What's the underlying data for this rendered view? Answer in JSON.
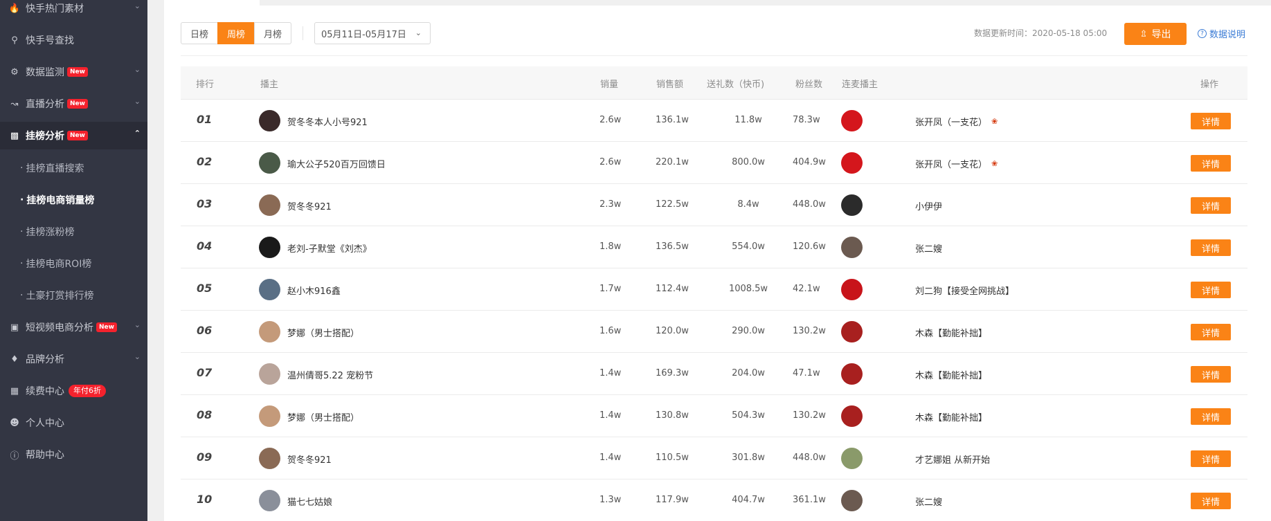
{
  "sidebar": {
    "items": [
      {
        "label": "快手热门素材",
        "icon": "fire-icon"
      },
      {
        "label": "快手号查找",
        "icon": "search-icon"
      },
      {
        "label": "数据监测",
        "icon": "monitor-icon",
        "badge": "New"
      },
      {
        "label": "直播分析",
        "icon": "line-chart-icon",
        "badge": "New"
      },
      {
        "label": "挂榜分析",
        "icon": "bar-chart-icon",
        "badge": "New"
      },
      {
        "label": "短视频电商分析",
        "icon": "shopping-bag-icon",
        "badge": "New"
      },
      {
        "label": "品牌分析",
        "icon": "diamond-icon"
      },
      {
        "label": "续费中心",
        "icon": "card-icon",
        "promo": "年付6折"
      },
      {
        "label": "个人中心",
        "icon": "user-icon"
      },
      {
        "label": "帮助中心",
        "icon": "help-circle-icon"
      }
    ],
    "sub_items": [
      {
        "label": "挂榜直播搜索"
      },
      {
        "label": "挂榜电商销量榜"
      },
      {
        "label": "挂榜涨粉榜"
      },
      {
        "label": "挂榜电商ROI榜"
      },
      {
        "label": "土豪打赏排行榜"
      }
    ],
    "sub_dot": "·"
  },
  "toolbar": {
    "tabs": [
      "日榜",
      "周榜",
      "月榜"
    ],
    "active_tab": "周榜",
    "date_range": "05月11日-05月17日",
    "update_time": "数据更新时间：2020-05-18 05:00",
    "export_label": "导出",
    "help_label": "数据说明"
  },
  "table": {
    "headers": {
      "rank": "排行",
      "streamer": "播主",
      "sales": "销量",
      "revenue": "销售额",
      "gifts": "送礼数（快币)",
      "fans": "粉丝数",
      "mic": "连麦播主",
      "action": "操作"
    },
    "detail_label": "详情",
    "rows": [
      {
        "rank": "01",
        "name": "贺冬冬本人小号921",
        "sales": "2.6w",
        "revenue": "136.1w",
        "gifts": "11.8w",
        "fans": "78.3w",
        "mic": "张开凤（一支花）",
        "rose": true,
        "avatar": "#3a2a2a",
        "mic_avatar": "#d4161c"
      },
      {
        "rank": "02",
        "name": "瑜大公子520百万回馈日",
        "sales": "2.6w",
        "revenue": "220.1w",
        "gifts": "800.0w",
        "fans": "404.9w",
        "mic": "张开凤（一支花）",
        "rose": true,
        "avatar": "#4a5a48",
        "mic_avatar": "#d4161c"
      },
      {
        "rank": "03",
        "name": "贺冬冬921",
        "sales": "2.3w",
        "revenue": "122.5w",
        "gifts": "8.4w",
        "fans": "448.0w",
        "mic": "小伊伊",
        "rose": false,
        "avatar": "#8a6a55",
        "mic_avatar": "#2b2b2b"
      },
      {
        "rank": "04",
        "name": "老刘-子默堂《刘杰》",
        "sales": "1.8w",
        "revenue": "136.5w",
        "gifts": "554.0w",
        "fans": "120.6w",
        "mic": "张二嫂",
        "rose": false,
        "avatar": "#1a1a1a",
        "mic_avatar": "#6b5a50"
      },
      {
        "rank": "05",
        "name": "赵小木916鑫",
        "sales": "1.7w",
        "revenue": "112.4w",
        "gifts": "1008.5w",
        "fans": "42.1w",
        "mic": "刘二狗【接受全网挑战】",
        "rose": false,
        "avatar": "#5a6f85",
        "mic_avatar": "#c8141a"
      },
      {
        "rank": "06",
        "name": "梦娜（男士搭配）",
        "sales": "1.6w",
        "revenue": "120.0w",
        "gifts": "290.0w",
        "fans": "130.2w",
        "mic": "木森【勤能补拙】",
        "rose": false,
        "avatar": "#c49a7a",
        "mic_avatar": "#a8201f"
      },
      {
        "rank": "07",
        "name": "温州倩哥5.22 宠粉节",
        "sales": "1.4w",
        "revenue": "169.3w",
        "gifts": "204.0w",
        "fans": "47.1w",
        "mic": "木森【勤能补拙】",
        "rose": false,
        "avatar": "#b9a49a",
        "mic_avatar": "#a8201f"
      },
      {
        "rank": "08",
        "name": "梦娜（男士搭配）",
        "sales": "1.4w",
        "revenue": "130.8w",
        "gifts": "504.3w",
        "fans": "130.2w",
        "mic": "木森【勤能补拙】",
        "rose": false,
        "avatar": "#c49a7a",
        "mic_avatar": "#a8201f"
      },
      {
        "rank": "09",
        "name": "贺冬冬921",
        "sales": "1.4w",
        "revenue": "110.5w",
        "gifts": "301.8w",
        "fans": "448.0w",
        "mic": "才艺娜姐 从新开始",
        "rose": false,
        "avatar": "#8a6a55",
        "mic_avatar": "#8a9a6a"
      },
      {
        "rank": "10",
        "name": "猫七七姑娘",
        "sales": "1.3w",
        "revenue": "117.9w",
        "gifts": "404.7w",
        "fans": "361.1w",
        "mic": "张二嫂",
        "rose": false,
        "avatar": "#8a8f9a",
        "mic_avatar": "#6b5a50"
      }
    ]
  },
  "colors": {
    "accent": "#fa8316",
    "sidebar_bg": "#333643",
    "badge_red": "#f5222d",
    "link_blue": "#3a7bd5"
  }
}
